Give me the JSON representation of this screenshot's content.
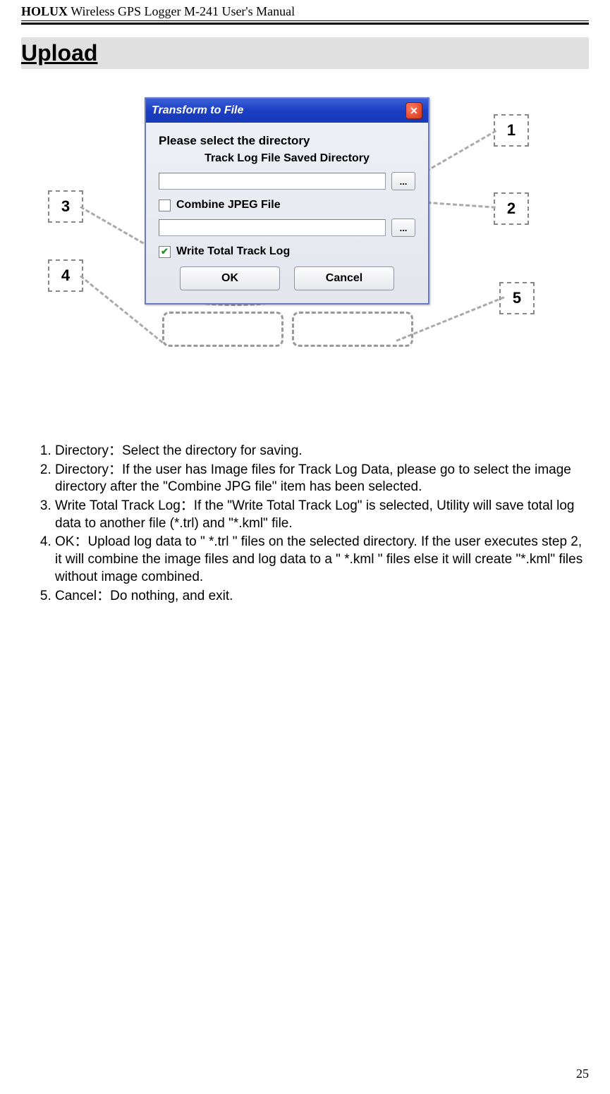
{
  "header": {
    "brand_bold": "HOLUX",
    "brand_rest": " Wireless GPS Logger M-241 User's Manual"
  },
  "section_title": "Upload",
  "dialog": {
    "title": "Transform to File",
    "close_glyph": "✕",
    "prompt": "Please select the directory",
    "subtitle": "Track Log File Saved Directory",
    "browse_label": "...",
    "combine_label": "Combine JPEG File",
    "write_total_label": "Write Total Track Log",
    "ok_label": "OK",
    "cancel_label": "Cancel"
  },
  "callouts": {
    "c1": "1",
    "c2": "2",
    "c3": "3",
    "c4": "4",
    "c5": "5"
  },
  "list": {
    "i1": "Directory：Select the directory for saving.",
    "i2": "Directory：If the user has Image files for Track Log Data, please go to select the image directory after the \"Combine JPG file\" item has been selected.",
    "i3": "Write Total Track Log：If the \"Write Total Track Log\" is selected, Utility will save total log data to another file (*.trl) and \"*.kml\" file.",
    "i4": "OK：Upload log data to \" *.trl \" files on the selected directory. If the user executes step 2, it will combine the image files and log data to a \" *.kml \" files else it will create \"*.kml\" files without image combined.",
    "i5": "Cancel：Do nothing, and exit."
  },
  "page_number": "25"
}
